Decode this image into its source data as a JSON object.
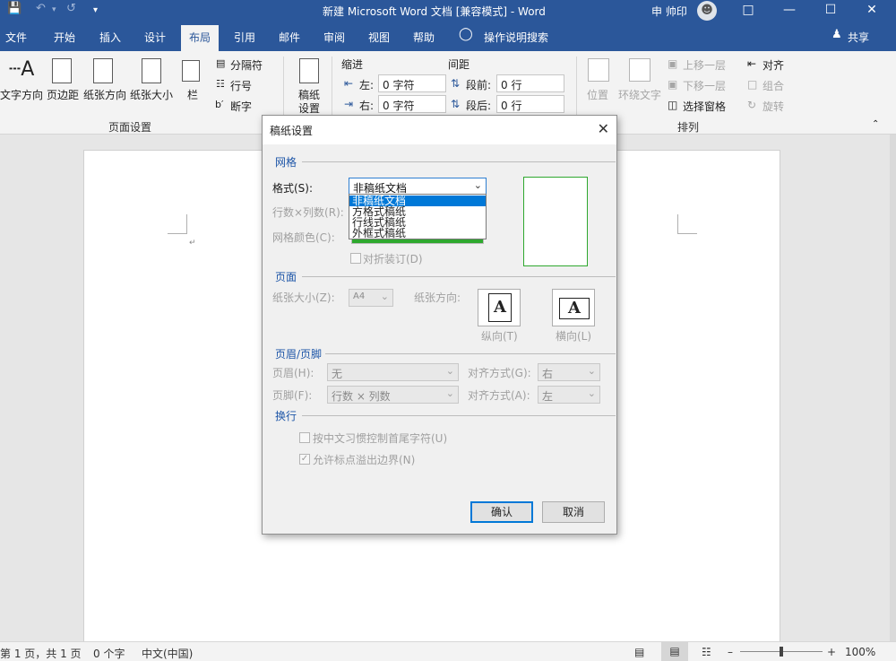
{
  "window": {
    "title": "新建 Microsoft Word 文档 [兼容模式] - Word",
    "user": "申 帅印",
    "share": "共享"
  },
  "tabs": [
    {
      "label": "文件"
    },
    {
      "label": "开始"
    },
    {
      "label": "插入"
    },
    {
      "label": "设计"
    },
    {
      "label": "布局"
    },
    {
      "label": "引用"
    },
    {
      "label": "邮件"
    },
    {
      "label": "审阅"
    },
    {
      "label": "视图"
    },
    {
      "label": "帮助"
    },
    {
      "label": "操作说明搜索"
    }
  ],
  "ribbon": {
    "page_setup": {
      "text_direction": "文字方向",
      "margins": "页边距",
      "orientation": "纸张方向",
      "size": "纸张大小",
      "columns": "栏",
      "breaks": "分隔符",
      "line_numbers": "行号",
      "hyphenation": "断字",
      "group_label": "页面设置"
    },
    "manuscript": {
      "label_line1": "稿纸",
      "label_line2": "设置"
    },
    "indent": {
      "title": "缩进",
      "left_label": "左:",
      "left_value": "0 字符",
      "right_label": "右:",
      "right_value": "0 字符"
    },
    "spacing": {
      "title": "间距",
      "before_label": "段前:",
      "before_value": "0 行",
      "after_label": "段后:",
      "after_value": "0 行"
    },
    "arrange": {
      "position": "位置",
      "wrap_text": "环绕文字",
      "bring_forward": "上移一层",
      "send_backward": "下移一层",
      "selection_pane": "选择窗格",
      "align": "对齐",
      "group": "组合",
      "rotate": "旋转",
      "group_label": "排列"
    }
  },
  "dialog": {
    "title": "稿纸设置",
    "grid_section": "网格",
    "format_label": "格式(S):",
    "format_value": "非稿纸文档",
    "format_options": [
      "非稿纸文档",
      "方格式稿纸",
      "行线式稿纸",
      "外框式稿纸"
    ],
    "rows_cols_label": "行数×列数(R):",
    "grid_color_label": "网格颜色(C):",
    "fold_binding": "对折装订(D)",
    "page_section": "页面",
    "paper_size_label": "纸张大小(Z):",
    "paper_size_value": "A4",
    "orientation_label": "纸张方向:",
    "portrait": "纵向(T)",
    "landscape": "横向(L)",
    "header_footer_section": "页眉/页脚",
    "header_label": "页眉(H):",
    "header_value": "无",
    "header_align_label": "对齐方式(G):",
    "header_align_value": "右",
    "footer_label": "页脚(F):",
    "footer_value": "行数 × 列数",
    "footer_align_label": "对齐方式(A):",
    "footer_align_value": "左",
    "line_break_section": "换行",
    "chk_chinese_rules": "按中文习惯控制首尾字符(U)",
    "chk_punct_overflow": "允许标点溢出边界(N)",
    "ok": "确认",
    "cancel": "取消"
  },
  "statusbar": {
    "page": "第 1 页，共 1 页",
    "words": "0 个字",
    "language": "中文(中国)",
    "zoom": "100%"
  },
  "colors": {
    "brand": "#2b579a",
    "accent": "#0078d7",
    "grid_green": "#2ea82e"
  }
}
